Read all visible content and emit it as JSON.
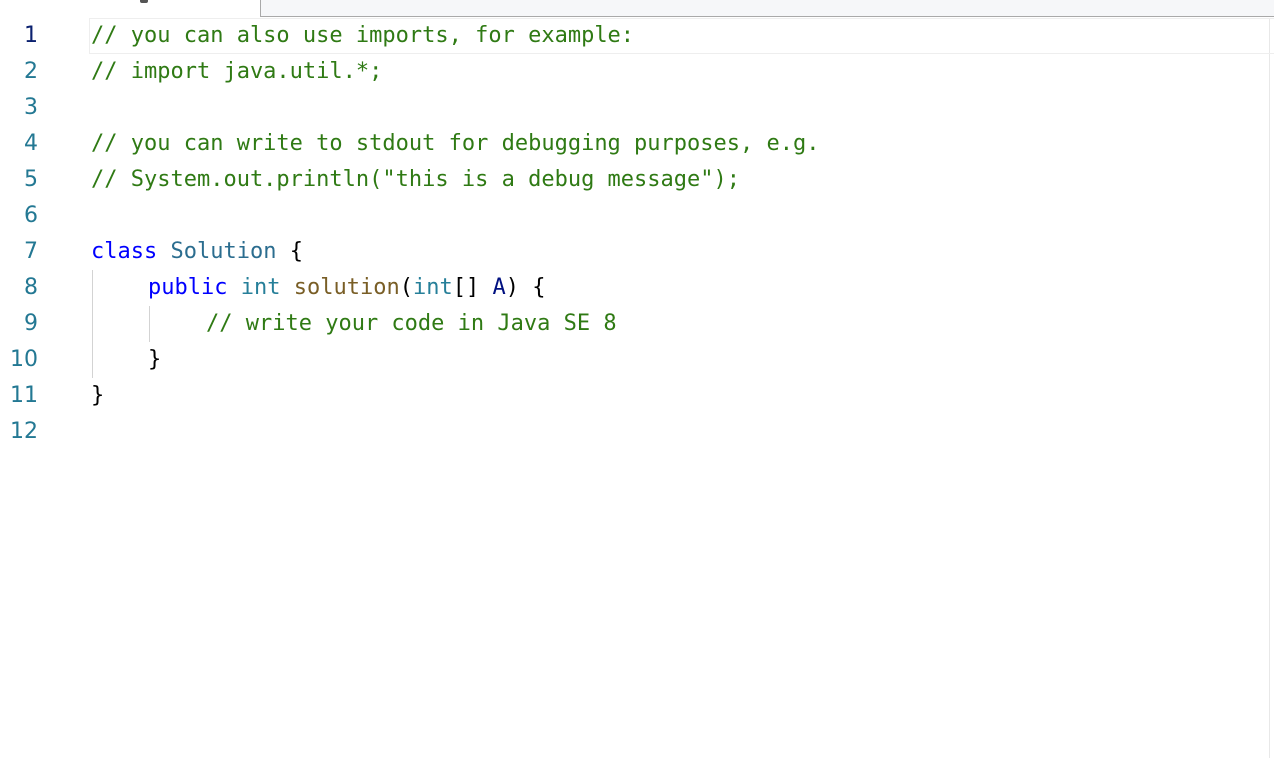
{
  "editor": {
    "language": "Java",
    "line_numbers": [
      "1",
      "2",
      "3",
      "4",
      "5",
      "6",
      "7",
      "8",
      "9",
      "10",
      "11",
      "12"
    ],
    "lines": {
      "l1": {
        "comment": "// you can also use imports, for example:"
      },
      "l2": {
        "comment": "// import java.util.*;"
      },
      "l4": {
        "comment": "// you can write to stdout for debugging purposes, e.g."
      },
      "l5": {
        "comment": "// System.out.println(\"this is a debug message\");"
      },
      "l7": {
        "kw": "class",
        "name": "Solution",
        "open": "{"
      },
      "l8": {
        "kw": "public",
        "ret_type": "int",
        "method": "solution",
        "lparen": "(",
        "param_type": "int",
        "brackets": "[]",
        "param": "A",
        "rparen": ")",
        "open": "{"
      },
      "l9": {
        "comment": "// write your code in Java SE 8"
      },
      "l10": {
        "close": "}"
      },
      "l11": {
        "close": "}"
      }
    }
  },
  "colors": {
    "comment": "#2f7a14",
    "keyword": "#0000ff",
    "type": "#267f99",
    "function": "#795e26",
    "parameter": "#001080",
    "line_number": "#237893",
    "current_line_number": "#0b216f"
  }
}
